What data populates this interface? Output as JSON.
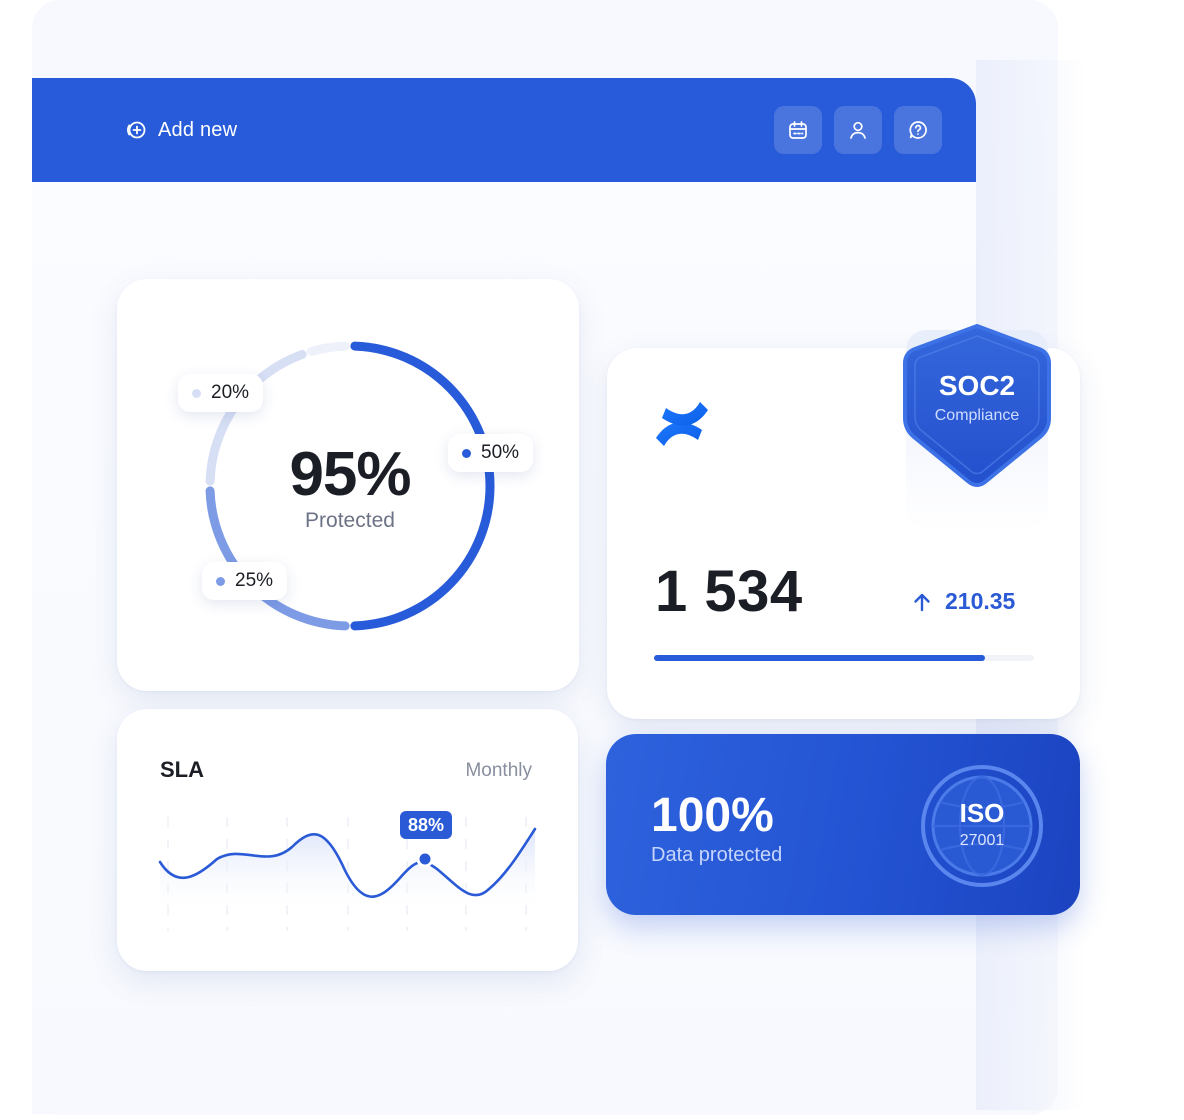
{
  "header": {
    "add_new_label": "Add new",
    "actions": [
      {
        "icon": "calendar-icon"
      },
      {
        "icon": "user-icon"
      },
      {
        "icon": "help-icon"
      }
    ]
  },
  "protection": {
    "value": "95%",
    "label": "Protected",
    "segments": [
      {
        "label": "50%",
        "fraction": 0.5,
        "color": "#285bd9"
      },
      {
        "label": "25%",
        "fraction": 0.25,
        "color": "#7e9ce6"
      },
      {
        "label": "20%",
        "fraction": 0.2,
        "color": "#d7dff5"
      }
    ]
  },
  "sla": {
    "title": "SLA",
    "period": "Monthly",
    "highlight": "88%"
  },
  "metric": {
    "value": "1 534",
    "delta": "210.35",
    "progress": 0.87
  },
  "soc2": {
    "title": "SOC2",
    "subtitle": "Compliance"
  },
  "iso": {
    "value": "100%",
    "label": "Data protected",
    "badge_title": "ISO",
    "badge_sub": "27001"
  },
  "colors": {
    "accent": "#285bd9",
    "accent_light": "#7e9ce6",
    "accent_pale": "#d7dff5"
  }
}
